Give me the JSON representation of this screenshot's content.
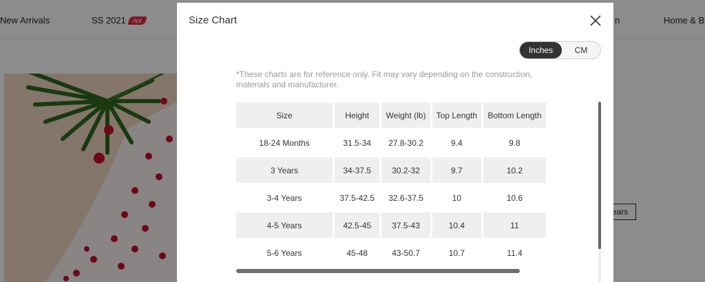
{
  "nav": {
    "new_arrivals": "New Arrivals",
    "ss2021": "SS 2021",
    "hot_badge": "hot",
    "partial_item": "n",
    "home_baby": "Home & Bab"
  },
  "background": {
    "years_chip": "ears"
  },
  "modal": {
    "title": "Size Chart",
    "close_icon": "close-icon",
    "units": {
      "inches": "Inches",
      "cm": "CM",
      "selected": "Inches"
    },
    "disclaimer": "*These charts are for reference only. Fit may vary depending on the construction, materials and manufacturer.",
    "table": {
      "headers": [
        "Size",
        "Height",
        "Weight (lb)",
        "Top Length",
        "Bottom Length"
      ],
      "rows": [
        [
          "18-24 Months",
          "31.5-34",
          "27.8-30.2",
          "9.4",
          "9.8"
        ],
        [
          "3 Years",
          "34-37.5",
          "30.2-32",
          "9.7",
          "10.2"
        ],
        [
          "3-4 Years",
          "37.5-42.5",
          "32.6-37.5",
          "10",
          "10.6"
        ],
        [
          "4-5 Years",
          "42.5-45",
          "37.5-43",
          "10.4",
          "11"
        ],
        [
          "5-6 Years",
          "45-48",
          "43-50.7",
          "10.7",
          "11.4"
        ]
      ]
    }
  },
  "colors": {
    "toggle_active_bg": "#333333",
    "header_bg": "#efefef",
    "disclaimer_text": "#999999",
    "hot_badge": "#e8294a"
  }
}
